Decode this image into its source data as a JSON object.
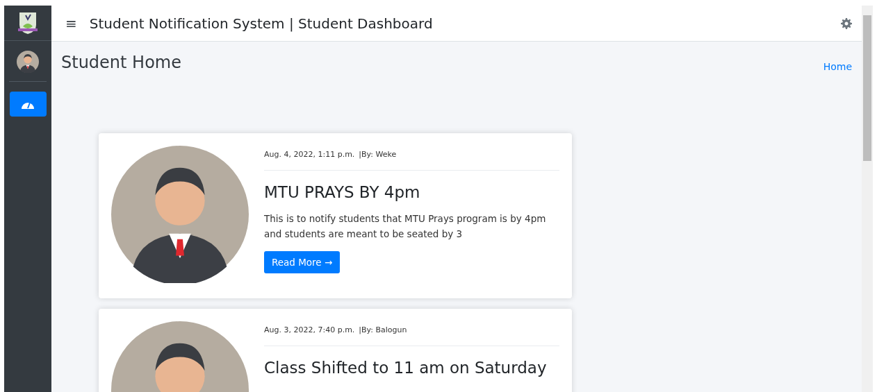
{
  "topbar": {
    "menu_glyph": "≡",
    "title": "Student Notification System | Student Dashboard"
  },
  "sidebar": {
    "items": [
      {
        "kind": "dashboard",
        "selected": true
      }
    ]
  },
  "page": {
    "heading": "Student Home",
    "breadcrumb": "Home"
  },
  "notifications": [
    {
      "date": "Aug. 4, 2022, 1:11 p.m.",
      "author": "|By: Weke",
      "title": "MTU PRAYS BY 4pm",
      "body": "This is to notify students that MTU Prays program is by 4pm and students are meant to be seated by 3",
      "button": "Read More →"
    },
    {
      "date": "Aug. 3, 2022, 7:40 p.m.",
      "author": "|By: Balogun",
      "title": "Class Shifted to 11 am on Saturday"
    }
  ]
}
